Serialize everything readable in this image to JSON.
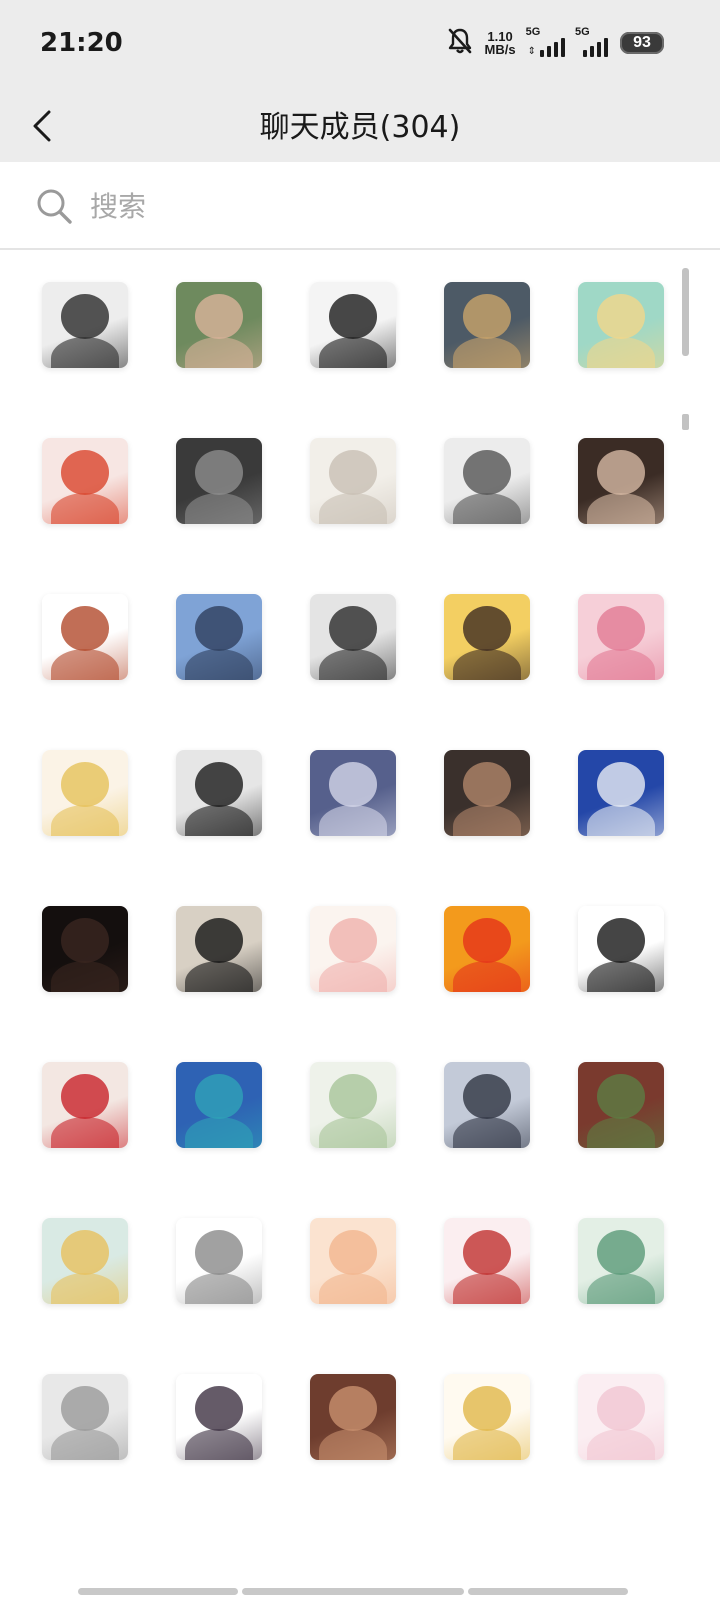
{
  "status_bar": {
    "time": "21:20",
    "speed_value": "1.10",
    "speed_unit": "MB/s",
    "network_1": "5G",
    "network_2": "5G",
    "battery": "93",
    "icons": [
      "bell-muted-icon",
      "signal-icon",
      "battery-icon"
    ]
  },
  "header": {
    "back_icon": "chevron-left-icon",
    "title": "聊天成员(304)"
  },
  "search": {
    "icon": "search-icon",
    "placeholder": "搜索",
    "value": ""
  },
  "members": [
    {
      "icon": "avatar-manga-boy-icon",
      "colors": [
        "#ededed",
        "#2a2a2a"
      ]
    },
    {
      "icon": "avatar-smiling-girl-photo-icon",
      "colors": [
        "#6e8a5e",
        "#d9b39a"
      ]
    },
    {
      "icon": "avatar-black-hair-girl-icon",
      "colors": [
        "#f4f4f4",
        "#1c1c1c"
      ]
    },
    {
      "icon": "avatar-room-lamp-photo-icon",
      "colors": [
        "#4d5a66",
        "#c9a46a"
      ]
    },
    {
      "icon": "avatar-blonde-girl-icon",
      "colors": [
        "#9fd8c6",
        "#f2d78a"
      ]
    },
    {
      "icon": "avatar-white-hair-girl-icon",
      "colors": [
        "#f7e6e3",
        "#d9452c"
      ]
    },
    {
      "icon": "avatar-hooded-figure-icon",
      "colors": [
        "#3a3a3a",
        "#8d8d8d"
      ]
    },
    {
      "icon": "avatar-smiling-anime-girl-icon",
      "colors": [
        "#f2efe9",
        "#c8bfb4"
      ]
    },
    {
      "icon": "avatar-sunglasses-boy-icon",
      "colors": [
        "#ececec",
        "#555555"
      ]
    },
    {
      "icon": "avatar-glasses-girl-photo-icon",
      "colors": [
        "#3b2c25",
        "#d6b9a4"
      ]
    },
    {
      "icon": "avatar-chibi-girl-icon",
      "colors": [
        "#ffffff",
        "#b24a2c"
      ]
    },
    {
      "icon": "avatar-bear-sea-photo-icon",
      "colors": [
        "#7fa3d6",
        "#2f3f5e"
      ]
    },
    {
      "icon": "avatar-manga-couple-icon",
      "colors": [
        "#e4e4e4",
        "#2b2b2b"
      ]
    },
    {
      "icon": "avatar-yellow-cartoon-girl-icon",
      "colors": [
        "#f3cf62",
        "#3e2c22"
      ]
    },
    {
      "icon": "avatar-pink-hair-girl-icon",
      "colors": [
        "#f6cfd8",
        "#e27a95"
      ]
    },
    {
      "icon": "avatar-snack-biscuit-icon",
      "colors": [
        "#fbf3e6",
        "#e6c25a"
      ]
    },
    {
      "icon": "avatar-panda-icon",
      "colors": [
        "#e6e6e6",
        "#1a1a1a"
      ]
    },
    {
      "icon": "avatar-winter-boy-icon",
      "colors": [
        "#56608c",
        "#d3d6e8"
      ]
    },
    {
      "icon": "avatar-sunset-portrait-icon",
      "colors": [
        "#3a302c",
        "#b0866a"
      ]
    },
    {
      "icon": "avatar-silver-hair-boy-icon",
      "colors": [
        "#2447a8",
        "#e8ecf4"
      ]
    },
    {
      "icon": "avatar-dark-room-icon",
      "colors": [
        "#140f0e",
        "#3a2620"
      ]
    },
    {
      "icon": "avatar-black-cat-icon",
      "colors": [
        "#d8d0c4",
        "#141414"
      ]
    },
    {
      "icon": "avatar-white-hair-chibi-icon",
      "colors": [
        "#fbf4ef",
        "#f0b1ad"
      ]
    },
    {
      "icon": "avatar-fire-cat-icon",
      "colors": [
        "#f39a1c",
        "#e5331a"
      ]
    },
    {
      "icon": "avatar-line-art-girl-icon",
      "colors": [
        "#ffffff",
        "#161616"
      ]
    },
    {
      "icon": "avatar-red-eye-girl-icon",
      "colors": [
        "#f3e7e2",
        "#c8232a"
      ]
    },
    {
      "icon": "avatar-mountain-lake-photo-icon",
      "colors": [
        "#2e62b4",
        "#2fa3b8"
      ]
    },
    {
      "icon": "avatar-green-hair-pair-icon",
      "colors": [
        "#eef2ea",
        "#a8c49a"
      ]
    },
    {
      "icon": "avatar-sleeping-boy-photo-icon",
      "colors": [
        "#c3cad8",
        "#2f3442"
      ]
    },
    {
      "icon": "avatar-garden-girl-photo-icon",
      "colors": [
        "#7a3a2e",
        "#5d7d43"
      ]
    },
    {
      "icon": "avatar-pink-glasses-chibi-icon",
      "colors": [
        "#d9eae4",
        "#e7c15e"
      ]
    },
    {
      "icon": "avatar-gray-dog-sunglasses-icon",
      "colors": [
        "#ffffff",
        "#8a8a8a"
      ]
    },
    {
      "icon": "avatar-pastel-orange-girl-icon",
      "colors": [
        "#fbe3d0",
        "#f2b58e"
      ]
    },
    {
      "icon": "avatar-christmas-girl-icon",
      "colors": [
        "#fbeef0",
        "#c0312f"
      ]
    },
    {
      "icon": "avatar-green-frog-girl-icon",
      "colors": [
        "#e3efe5",
        "#5a9a78"
      ]
    },
    {
      "icon": "avatar-gray-sketch-girl-icon",
      "colors": [
        "#e8e8e8",
        "#9a9a9a"
      ]
    },
    {
      "icon": "avatar-cap-chibi-icon",
      "colors": [
        "#ffffff",
        "#3e3242"
      ]
    },
    {
      "icon": "avatar-brown-portrait-icon",
      "colors": [
        "#6e3d2e",
        "#c8906e"
      ]
    },
    {
      "icon": "avatar-bear-hood-girl-icon",
      "colors": [
        "#fffaf0",
        "#e1b84a"
      ]
    },
    {
      "icon": "avatar-cute-bunny-icon",
      "colors": [
        "#fbeef2",
        "#f1c6d2"
      ]
    }
  ]
}
